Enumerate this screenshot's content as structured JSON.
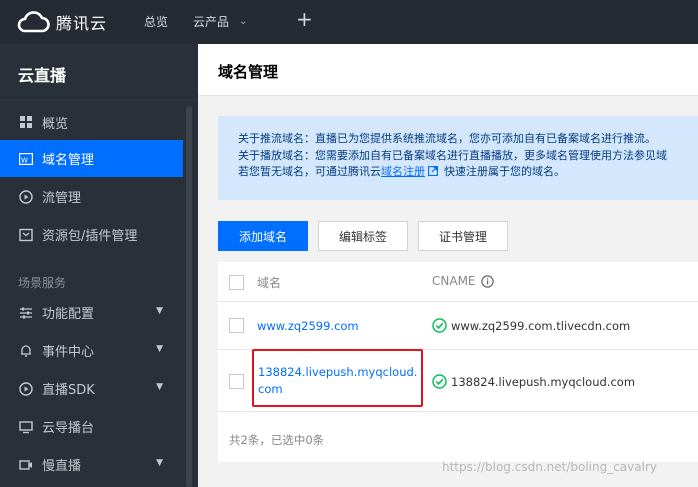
{
  "topbar": {
    "brand": "腾讯云",
    "overview": "总览",
    "products": "云产品",
    "plus": "+"
  },
  "sidebar": {
    "title": "云直播",
    "items": [
      {
        "label": "概览",
        "icon": "grid-icon"
      },
      {
        "label": "域名管理",
        "icon": "web-icon",
        "active": true
      },
      {
        "label": "流管理",
        "icon": "play-circle-icon"
      },
      {
        "label": "资源包/插件管理",
        "icon": "package-icon"
      }
    ],
    "section_label": "场景服务",
    "scene_items": [
      {
        "label": "功能配置",
        "icon": "sliders-icon"
      },
      {
        "label": "事件中心",
        "icon": "bell-icon"
      },
      {
        "label": "直播SDK",
        "icon": "play-icon"
      },
      {
        "label": "云导播台",
        "icon": "monitor-icon"
      },
      {
        "label": "慢直播",
        "icon": "camera-icon"
      }
    ]
  },
  "content": {
    "page_title": "域名管理",
    "notice": {
      "line1": "关于推流域名：直播已为您提供系统推流域名，您亦可添加自有已备案域名进行推流。",
      "line2": "关于播放域名：您需要添加自有已备案域名进行直播播放，更多域名管理使用方法参见域",
      "line3_pre": "若您暂无域名，可通过腾讯云",
      "line3_link": "域名注册",
      "line3_post": "快速注册属于您的域名。"
    },
    "buttons": {
      "add_domain": "添加域名",
      "edit_tags": "编辑标签",
      "cert_manage": "证书管理"
    },
    "table": {
      "col_domain": "域名",
      "col_cname": "CNAME",
      "rows": [
        {
          "domain": "www.zq2599.com",
          "cname": "www.zq2599.com.tlivecdn.com"
        },
        {
          "domain": "138824.livepush.myqcloud.com",
          "cname": "138824.livepush.myqcloud.com"
        }
      ],
      "footer": "共2条，已选中0条"
    }
  },
  "watermark": "https://blog.csdn.net/boling_cavalry",
  "colors": {
    "topbar": "#252a33",
    "sidebar": "#293039",
    "accent": "#006eff",
    "highlight": "#e0141e",
    "success": "#0abf5b"
  }
}
